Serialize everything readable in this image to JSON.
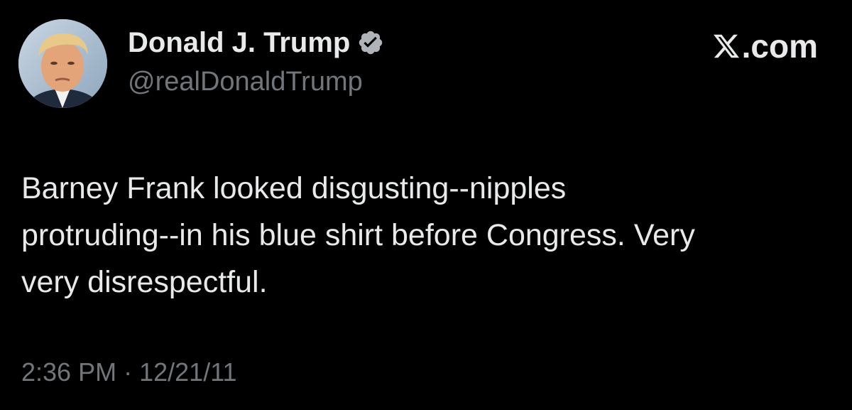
{
  "author": {
    "display_name": "Donald J. Trump",
    "handle": "@realDonaldTrump",
    "verified": true,
    "verified_icon": "verified-badge-icon",
    "avatar_icon": "profile-photo-avatar"
  },
  "brand": {
    "logo_icon": "x-logo-icon",
    "text": ".com"
  },
  "tweet": {
    "lines": [
      "Barney Frank looked disgusting--nipples",
      "protruding--in his blue shirt before Congress. Very",
      "very disrespectful."
    ]
  },
  "meta": {
    "time": "2:36 PM",
    "separator": "·",
    "date": "12/21/11"
  },
  "colors": {
    "background": "#000000",
    "primary_text": "#e7e9ea",
    "secondary_text": "#71767b",
    "verified_badge": "#b0b3b8"
  }
}
